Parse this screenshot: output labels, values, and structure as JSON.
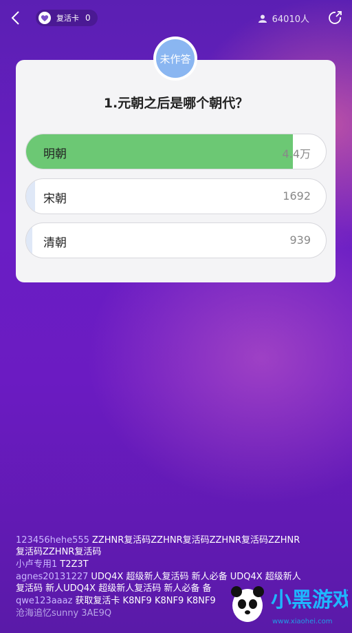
{
  "header": {
    "revive_label": "复活卡",
    "revive_count": "0",
    "online_count": "64010人"
  },
  "quiz": {
    "status_badge": "未作答",
    "question": "1.元朝之后是哪个朝代？",
    "options": [
      {
        "label": "明朝",
        "count": "4.4万",
        "share": 0.89
      },
      {
        "label": "宋朝",
        "count": "1692",
        "share": 0.03
      },
      {
        "label": "清朝",
        "count": "939",
        "share": 0.02
      }
    ]
  },
  "comments": [
    {
      "user": "123456hehe555",
      "text": "ZZHNR复活码ZZHNR复活码ZZHNR复活码ZZHNR复活码ZZHNR复活码"
    },
    {
      "user": "小卢专用1",
      "text": "T2Z3T"
    },
    {
      "user": "agnes20131227",
      "text": "UDQ4X 超级新人复活码 新人必备 UDQ4X 超级新人复活码 新人UDQ4X 超级新人复活码 新人必备 备"
    },
    {
      "user": "qwe123aaaz",
      "text": "获取复活卡 K8NF9 K8NF9 K8NF9"
    },
    {
      "user": "沧海追忆sunny",
      "text": "3AE9Q"
    }
  ],
  "watermark": {
    "brand": "小黑游戏",
    "url": "www.xiaohei.com"
  },
  "colors": {
    "correct_fill": "#6cc874",
    "badge": "#8ab6f1"
  }
}
